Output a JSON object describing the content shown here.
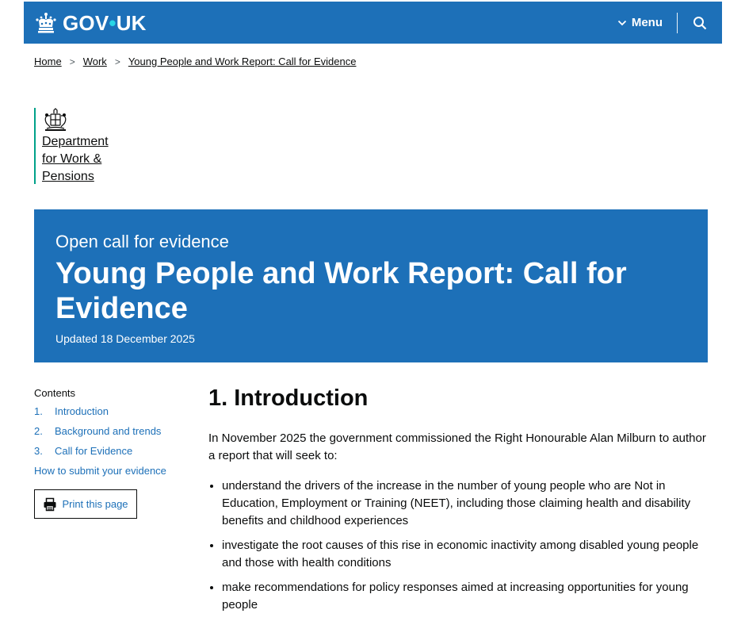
{
  "header": {
    "logo_text_gov": "GOV",
    "logo_dot": "•",
    "logo_text_uk": "UK",
    "menu_label": "Menu",
    "search_icon": "search-icon"
  },
  "breadcrumb": {
    "items": [
      "Home",
      "Work",
      "Young People and Work Report: Call for Evidence"
    ],
    "separator": ">"
  },
  "organisation": {
    "name": "Department for Work & Pensions"
  },
  "hero": {
    "caption": "Open call for evidence",
    "title": "Young People and Work Report: Call for Evidence",
    "updated": "Updated 18 December 2025"
  },
  "contents": {
    "heading": "Contents",
    "items": [
      {
        "num": "1.",
        "label": "Introduction"
      },
      {
        "num": "2.",
        "label": "Background and trends"
      },
      {
        "num": "3.",
        "label": "Call for Evidence"
      }
    ],
    "extra_link": "How to submit your evidence",
    "print_label": "Print this page"
  },
  "main": {
    "heading": "1. Introduction",
    "intro": "In November 2025 the government commissioned the Right Honourable Alan Milburn to author a report that will seek to:",
    "bullets": [
      "understand the drivers of the increase in the number of young people who are Not in Education, Employment or Training (NEET), including those claiming health and disability benefits and childhood experiences",
      "investigate the root causes of this rise in economic inactivity among disabled young people and those with health conditions",
      "make recommendations for policy responses aimed at increasing opportunities for young people"
    ]
  },
  "colors": {
    "brand_blue": "#1d70b8",
    "org_accent": "#00a189",
    "text": "#0b0c0c"
  }
}
